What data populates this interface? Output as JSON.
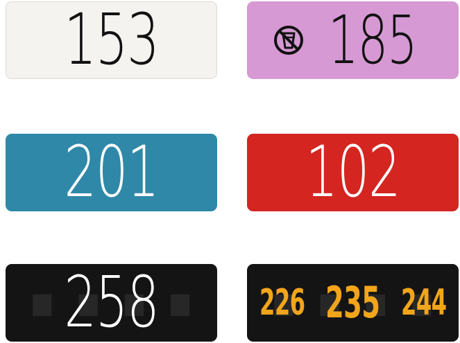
{
  "plates": [
    {
      "id": "white",
      "number": "153",
      "bg": "#f4f3ef",
      "fg": "#111111"
    },
    {
      "id": "lilac",
      "number": "185",
      "bg": "#d699d3",
      "fg": "#111111",
      "icon": "no-drinking-cup-icon"
    },
    {
      "id": "blue",
      "number": "201",
      "bg": "#2f88a8",
      "fg": "#ffffff"
    },
    {
      "id": "red",
      "number": "102",
      "bg": "#d42521",
      "fg": "#ffffff"
    },
    {
      "id": "black-white",
      "number": "258",
      "bg": "#141414",
      "fg": "#ffffff"
    },
    {
      "id": "black-orange",
      "numbers": [
        "226",
        "235",
        "244"
      ],
      "bg": "#141414",
      "fg": "#f2a51b"
    }
  ]
}
